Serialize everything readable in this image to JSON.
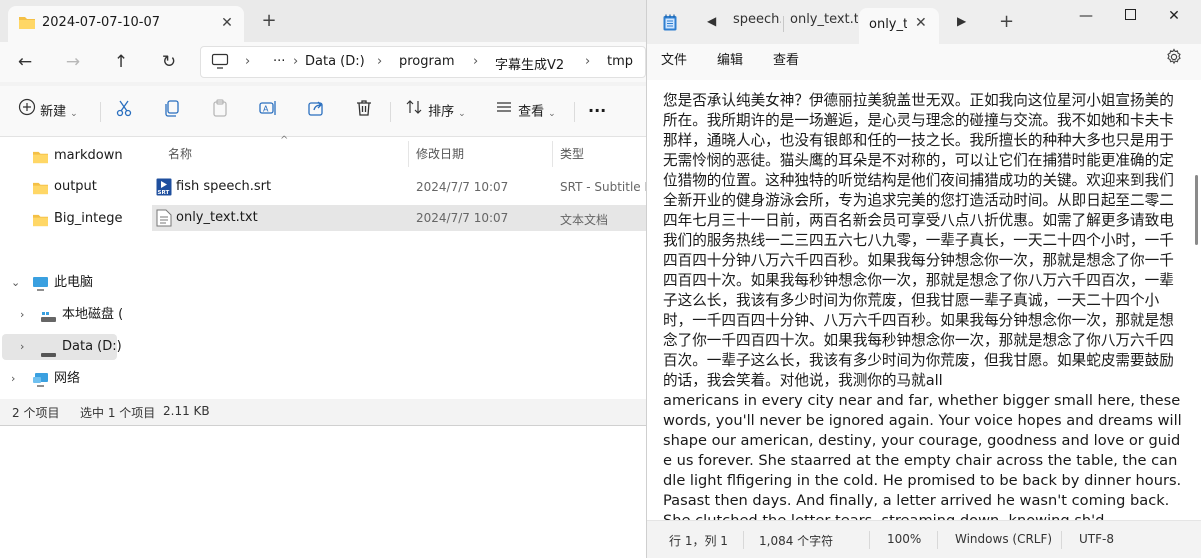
{
  "explorer": {
    "tab_title": "2024-07-07-10-07",
    "tab_close": "✕",
    "new_tab": "+",
    "breadcrumbs": [
      "Data (D:)",
      "program",
      "字幕生成V2",
      "tmp"
    ],
    "breadcrumb_more": "···",
    "commands": {
      "new_label": "新建",
      "sort_label": "排序",
      "view_label": "查看",
      "more": "···"
    },
    "sidebar": {
      "items": [
        {
          "label": "markdown"
        },
        {
          "label": "output"
        },
        {
          "label": "Big_integer"
        },
        {
          "label": "此电脑"
        },
        {
          "label": "本地磁盘 ("
        },
        {
          "label": "Data (D:)"
        },
        {
          "label": "网络"
        }
      ]
    },
    "columns": {
      "name": "名称",
      "modified": "修改日期",
      "type": "类型"
    },
    "files": [
      {
        "name": "fish speech.srt",
        "modified": "2024/7/7 10:07",
        "type": "SRT - Subtitle F"
      },
      {
        "name": "only_text.txt",
        "modified": "2024/7/7 10:07",
        "type": "文本文档"
      }
    ],
    "status": {
      "count": "2 个项目",
      "selection": "选中 1 个项目",
      "size": "2.11 KB"
    }
  },
  "notepad": {
    "tabs": [
      {
        "label": "speech.t"
      },
      {
        "label": "only_text.txt"
      },
      {
        "label": "only_t"
      }
    ],
    "tab_close": "✕",
    "new_tab": "+",
    "menu": {
      "file": "文件",
      "edit": "编辑",
      "view": "查看"
    },
    "content": "您是否承认纯美女神？伊德丽拉美貌盖世无双。正如我向这位星河小姐宣扬美的所在。我所期许的是一场邂逅，是心灵与理念的碰撞与交流。我不如她和卡夫卡那样，通晓人心，也没有银郎和任的一技之长。我所擅长的种种大多也只是用于无需怜悯的恶徒。猫头鹰的耳朵是不对称的，可以让它们在捕猎时能更准确的定位猎物的位置。这种独特的听觉结构是他们夜间捕猎成功的关键。欢迎来到我们全新开业的健身游泳会所，专为追求完美的您打造活动时间。从即日起至二零二四年七月三十一日前，两百名新会员可享受八点八折优惠。如需了解更多请致电我们的服务热线一二三四五六七八九零，一辈子真长，一天二十四个小时，一千四百四十分钟八万六千四百秒。如果我每分钟想念你一次，那就是想念了你一千四百四十次。如果我每秒钟想念你一次，那就是想念了你八万六千四百次，一辈子这么长，我该有多少时间为你荒废，但我甘愿一辈子真诚，一天二十四个小时，一千四百四十分钟、八万六千四百秒。如果我每分钟想念你一次，那就是想念了你一千四百四十次。如果我每秒钟想念你一次，那就是想念了你八万六千四百次。一辈子这么长，我该有多少时间为你荒废，但我甘愿。如果蛇皮需要鼓励的话，我会笑着。对他说，我测你的马就all\namericans in every city near and far, whether bigger small here, these words, you'll never be ignored again. Your voice hopes and dreams will shape our american, destiny, your courage, goodness and love or guide us forever. She staarred at the empty chair across the table, the candle light flfigering in the cold. He promised to be back by dinner hours. Pasast then days. And finally, a letter arrived he wasn't coming back. She clutched the letter tears, streaming down, knowing sh'd",
    "status": {
      "position": "行 1，列 1",
      "chars": "1,084 个字符",
      "zoom": "100%",
      "line_ending": "Windows (CRLF)",
      "encoding": "UTF-8"
    }
  }
}
